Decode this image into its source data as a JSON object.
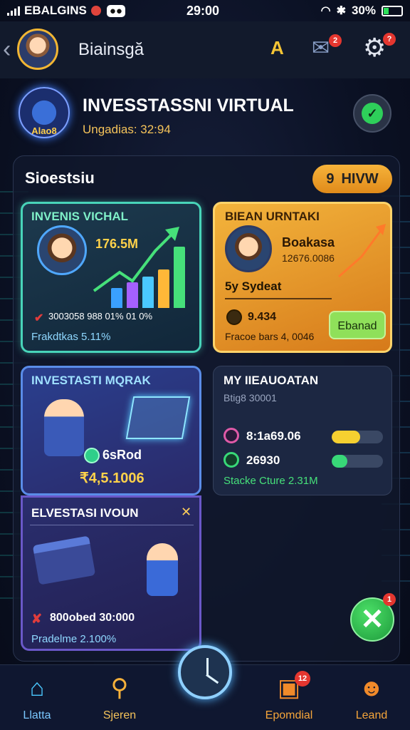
{
  "status_bar": {
    "carrier": "EBALGINS",
    "time": "29:00",
    "battery": "30%"
  },
  "header": {
    "title": "Biainsgă",
    "notification_badge": "2",
    "settings_badge": "?"
  },
  "hero": {
    "logo_text": "Alao8",
    "title": "INVESSTASSNI VIRTUAL",
    "subtitle": "Ungadias: 32:94"
  },
  "panel": {
    "title": "Sioestsiu",
    "pill_number": "9",
    "pill_label": "HIVW"
  },
  "card1": {
    "title": "INVENIS VICHAL",
    "value": "176.5M",
    "stats_row": "3003058  988  01% 01  0%",
    "footer": "Frakdtkas 5.11%"
  },
  "card2": {
    "title": "BIEAN URNTAKI",
    "name": "Boakasa",
    "amount": "12676.0086",
    "caption": "5y Sydeat",
    "coin_value": "9.434",
    "footer": "Fracoe bars 4, 0046",
    "button": "Ebanad"
  },
  "card3": {
    "title": "INVESTASTI MQRAK",
    "coin_label": "6sRod",
    "amount": "₹4,5.1006"
  },
  "card4": {
    "title": "MY IIEAUOATAN",
    "subtitle": "Btig8 30001",
    "row1_value": "8:1a69.06",
    "row1_progress": 0.55,
    "row2_value": "26930",
    "row2_progress": 0.3,
    "footer": "Stacke Cture 2.31M"
  },
  "card5": {
    "title": "ELVESTASI IVOUN",
    "line": "800obed 30:000",
    "footer": "Pradelme 2.100%"
  },
  "fab_badge": "1",
  "nav": {
    "items": [
      {
        "label": "Llatta",
        "icon": "home-icon"
      },
      {
        "label": "Sjeren",
        "icon": "search-icon"
      },
      {
        "label": "Epomdial",
        "icon": "gift-icon",
        "badge": "12"
      },
      {
        "label": "Leand",
        "icon": "user-icon"
      }
    ]
  },
  "colors": {
    "accent_teal": "#48d4b9",
    "accent_orange": "#f3b43c",
    "accent_green": "#2ecf5a",
    "badge_red": "#e4362f"
  }
}
